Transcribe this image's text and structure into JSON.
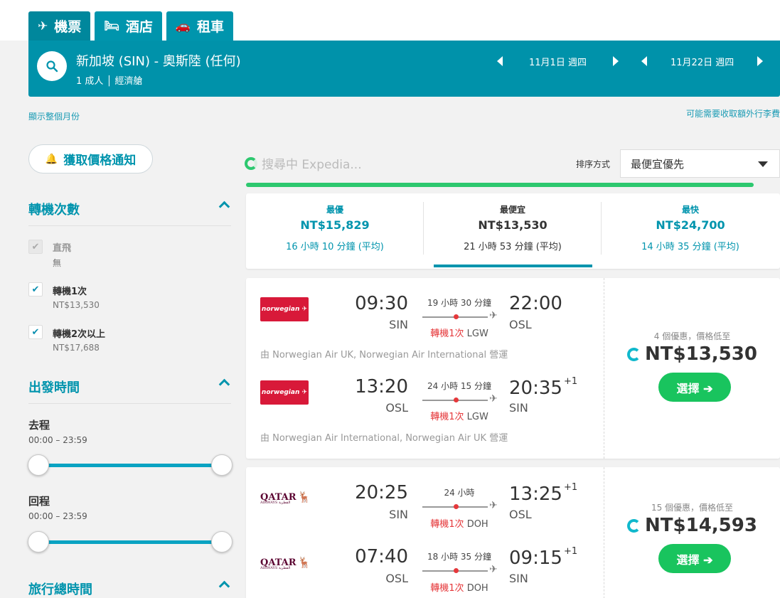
{
  "tabs": [
    {
      "icon": "✈",
      "label": "機票"
    },
    {
      "icon": "🛏",
      "label": "酒店"
    },
    {
      "icon": "🚗",
      "label": "租車"
    }
  ],
  "search": {
    "route": "新加坡 (SIN) - 奧斯陸 (任何)",
    "passengers": "1 成人 │ 經濟艙",
    "depart_date": "11月1日 週四",
    "return_date": "11月22日 週四"
  },
  "links": {
    "show_month": "顯示整個月份",
    "fees_note": "可能需要收取額外行李費"
  },
  "alert_button": "獲取價格通知",
  "filters": {
    "stops_title": "轉機次數",
    "stops": [
      {
        "label": "直飛",
        "sub": "無",
        "checked": true,
        "disabled": true
      },
      {
        "label": "轉機1次",
        "sub": "NT$13,530",
        "checked": true,
        "disabled": false
      },
      {
        "label": "轉機2次以上",
        "sub": "NT$17,688",
        "checked": true,
        "disabled": false
      }
    ],
    "departure_title": "出發時間",
    "outbound_label": "去程",
    "outbound_range": "00:00 – 23:59",
    "return_label": "回程",
    "return_range": "00:00 – 23:59",
    "duration_title": "旅行總時間"
  },
  "searching_text": "搜尋中 Expedia...",
  "sort": {
    "label": "排序方式",
    "value": "最便宜優先"
  },
  "summary": [
    {
      "title": "最優",
      "price": "NT$15,829",
      "duration": "16 小時 10 分鐘 (平均)",
      "color": "#0094ad"
    },
    {
      "title": "最便宜",
      "price": "NT$13,530",
      "duration": "21 小時 53 分鐘 (平均)",
      "color": "#333333"
    },
    {
      "title": "最快",
      "price": "NT$24,700",
      "duration": "14 小時 35 分鐘 (平均)",
      "color": "#0094ad"
    }
  ],
  "results": [
    {
      "legs": [
        {
          "airline": "norwegian",
          "dep_time": "09:30",
          "dep_code": "SIN",
          "duration": "19 小時 30 分鐘",
          "stop_text": "轉機1次",
          "stop_code": "LGW",
          "arr_time": "22:00",
          "arr_day": "",
          "arr_code": "OSL",
          "operated": "由 Norwegian Air UK, Norwegian Air International 營運"
        },
        {
          "airline": "norwegian",
          "dep_time": "13:20",
          "dep_code": "OSL",
          "duration": "24 小時 15 分鐘",
          "stop_text": "轉機1次",
          "stop_code": "LGW",
          "arr_time": "20:35",
          "arr_day": "+1",
          "arr_code": "SIN",
          "operated": "由 Norwegian Air International, Norwegian Air UK 營運"
        }
      ],
      "deals": "4 個優惠，價格低至",
      "price": "NT$13,530",
      "select": "選擇 ➔"
    },
    {
      "legs": [
        {
          "airline": "QATAR",
          "dep_time": "20:25",
          "dep_code": "SIN",
          "duration": "24 小時",
          "stop_text": "轉機1次",
          "stop_code": "DOH",
          "arr_time": "13:25",
          "arr_day": "+1",
          "arr_code": "OSL"
        },
        {
          "airline": "QATAR",
          "dep_time": "07:40",
          "dep_code": "OSL",
          "duration": "18 小時 35 分鐘",
          "stop_text": "轉機1次",
          "stop_code": "DOH",
          "arr_time": "09:15",
          "arr_day": "+1",
          "arr_code": "SIN"
        }
      ],
      "deals": "15 個優惠，價格低至",
      "price": "NT$14,593",
      "select": "選擇 ➔"
    }
  ],
  "colors": {
    "brand": "#0094ad",
    "green": "#19c45e",
    "stop_red": "#e5383b"
  }
}
